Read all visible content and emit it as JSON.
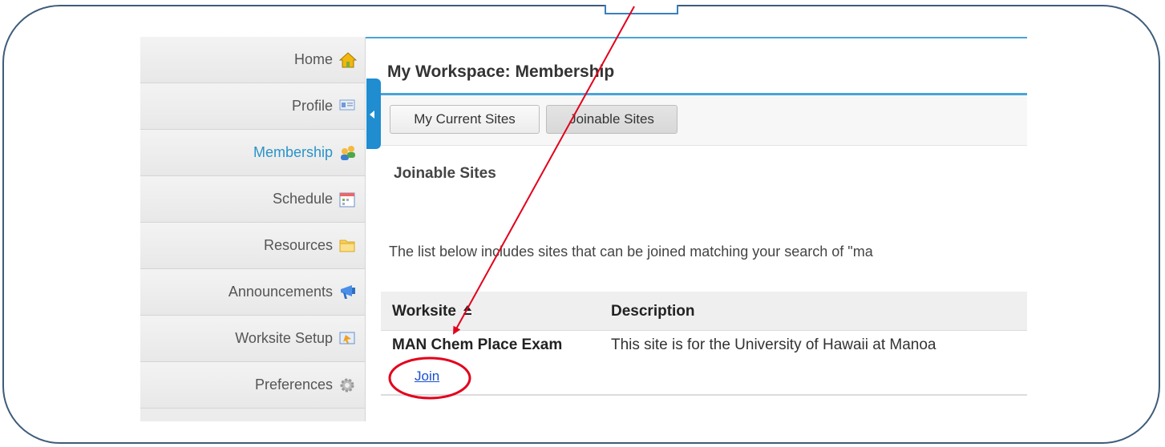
{
  "sidebar": {
    "items": [
      {
        "label": "Home",
        "icon": "home-icon"
      },
      {
        "label": "Profile",
        "icon": "profile-icon"
      },
      {
        "label": "Membership",
        "icon": "membership-icon",
        "active": true
      },
      {
        "label": "Schedule",
        "icon": "schedule-icon"
      },
      {
        "label": "Resources",
        "icon": "folder-icon"
      },
      {
        "label": "Announcements",
        "icon": "announcements-icon"
      },
      {
        "label": "Worksite Setup",
        "icon": "worksite-setup-icon"
      },
      {
        "label": "Preferences",
        "icon": "gear-icon"
      }
    ]
  },
  "header": {
    "title": "My Workspace: Membership"
  },
  "tabs": [
    {
      "label": "My Current Sites",
      "selected": false
    },
    {
      "label": "Joinable Sites",
      "selected": true
    }
  ],
  "main": {
    "section_heading": "Joinable Sites",
    "instructions": "The list below includes sites that can be joined matching your search of \"ma"
  },
  "table": {
    "columns": [
      "Worksite",
      "Description"
    ],
    "rows": [
      {
        "worksite": "MAN Chem Place Exam",
        "description": "This site is for the University of Hawaii at Manoa",
        "action": "Join"
      }
    ]
  },
  "colors": {
    "accent": "#2a93c9",
    "annotation": "#e3001b",
    "link": "#1a4fd0"
  }
}
